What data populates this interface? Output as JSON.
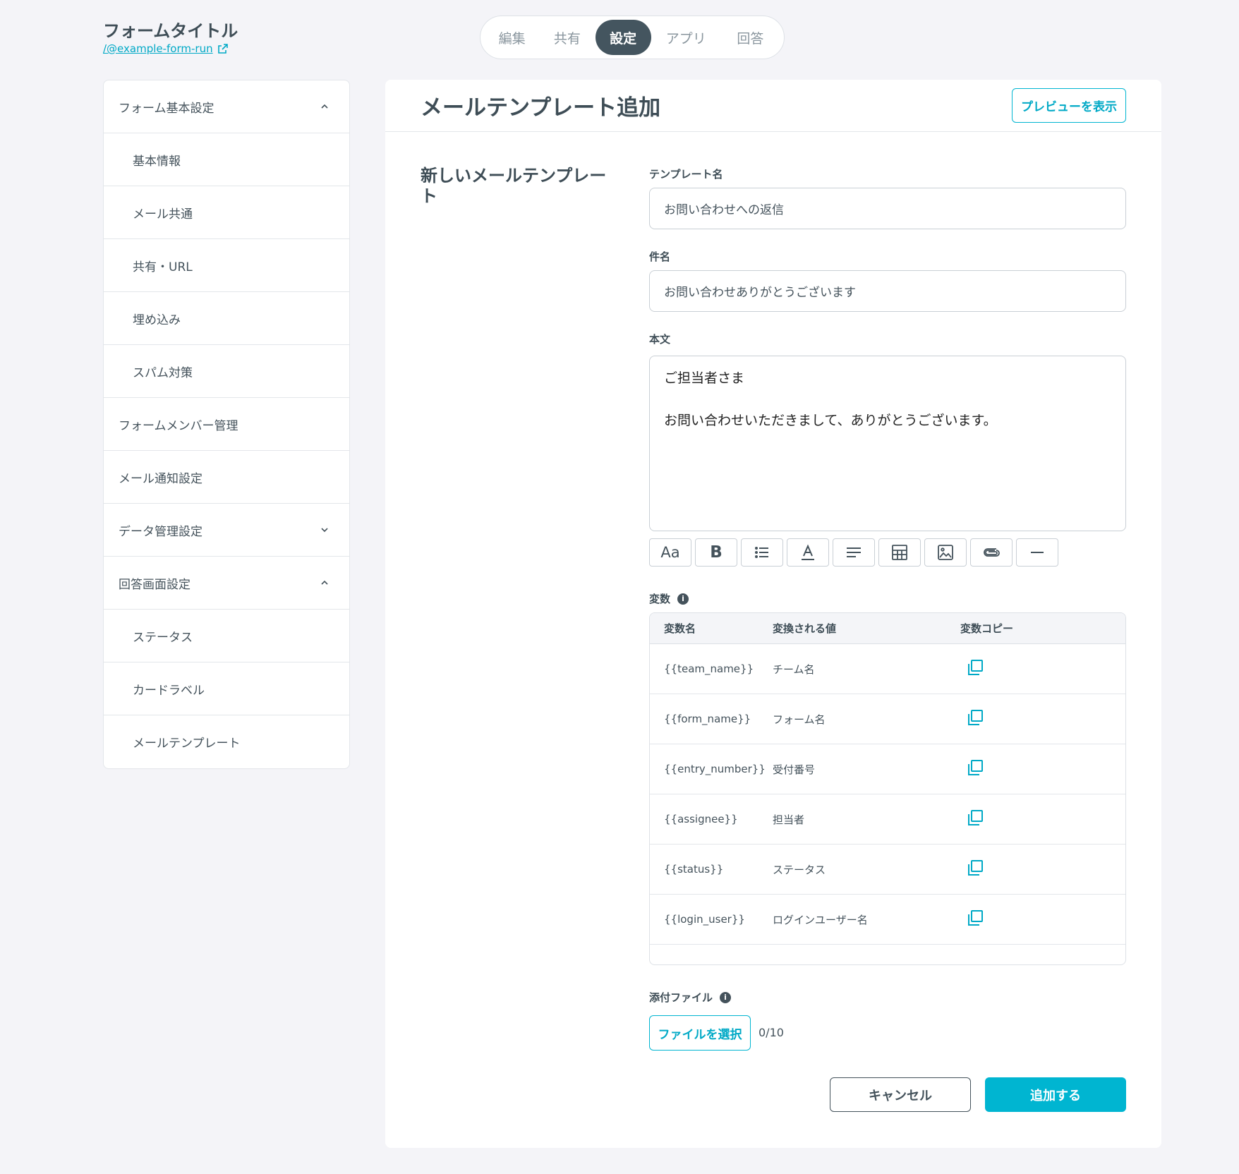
{
  "header": {
    "form_title": "フォームタイトル",
    "form_link": "/@example-form-run"
  },
  "tabs": [
    {
      "label": "編集",
      "active": false
    },
    {
      "label": "共有",
      "active": false
    },
    {
      "label": "設定",
      "active": true
    },
    {
      "label": "アプリ",
      "active": false
    },
    {
      "label": "回答",
      "active": false
    }
  ],
  "sidebar": {
    "items": [
      {
        "label": "フォーム基本設定",
        "level": 0,
        "chevron": "chevron-up-icon"
      },
      {
        "label": "基本情報",
        "level": 1
      },
      {
        "label": "メール共通",
        "level": 1
      },
      {
        "label": "共有・URL",
        "level": 1
      },
      {
        "label": "埋め込み",
        "level": 1
      },
      {
        "label": "スパム対策",
        "level": 1
      },
      {
        "label": "フォームメンバー管理",
        "level": 0
      },
      {
        "label": "メール通知設定",
        "level": 0
      },
      {
        "label": "データ管理設定",
        "level": 0,
        "chevron": "chevron-down-icon"
      },
      {
        "label": "回答画面設定",
        "level": 0,
        "chevron": "chevron-up-icon"
      },
      {
        "label": "ステータス",
        "level": 1
      },
      {
        "label": "カードラベル",
        "level": 1
      },
      {
        "label": "メールテンプレート",
        "level": 1
      }
    ]
  },
  "main": {
    "title": "メールテンプレート追加",
    "preview_label": "プレビューを表示",
    "section_title": "新しいメールテンプレート",
    "template_name": {
      "label": "テンプレート名",
      "value": "お問い合わせへの返信"
    },
    "subject": {
      "label": "件名",
      "value": "お問い合わせありがとうございます"
    },
    "body": {
      "label": "本文",
      "line1": "ご担当者さま",
      "line2": "お問い合わせいただきまして、ありがとうございます。"
    },
    "toolbar": [
      {
        "icon": "font-size-icon",
        "text": "Aa"
      },
      {
        "icon": "bold-icon",
        "text": "B"
      },
      {
        "icon": "list-icon"
      },
      {
        "icon": "text-color-icon"
      },
      {
        "icon": "align-icon"
      },
      {
        "icon": "table-icon"
      },
      {
        "icon": "image-icon"
      },
      {
        "icon": "attachment-icon"
      },
      {
        "icon": "horizontal-rule-icon"
      }
    ],
    "variables": {
      "label": "変数",
      "headers": [
        "変数名",
        "変換される値",
        "変数コピー"
      ],
      "rows": [
        {
          "name": "{{team_name}}",
          "value": "チーム名"
        },
        {
          "name": "{{form_name}}",
          "value": "フォーム名"
        },
        {
          "name": "{{entry_number}}",
          "value": "受付番号"
        },
        {
          "name": "{{assignee}}",
          "value": "担当者"
        },
        {
          "name": "{{status}}",
          "value": "ステータス"
        },
        {
          "name": "{{login_user}}",
          "value": "ログインユーザー名"
        }
      ]
    },
    "attachment": {
      "label": "添付ファイル",
      "button_label": "ファイルを選択",
      "count": "0/10"
    },
    "cancel_label": "キャンセル",
    "submit_label": "追加する"
  },
  "colors": {
    "accent": "#00b5d1",
    "active_tab": "#44555f",
    "background": "#f4f4f8"
  }
}
